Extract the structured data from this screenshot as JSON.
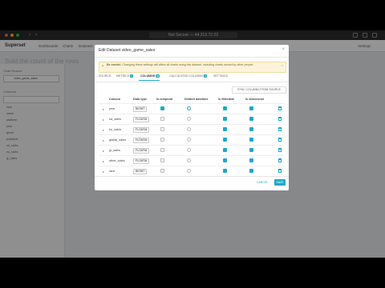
{
  "browser": {
    "url": "Not Secure — 44.213.72.22"
  },
  "app": {
    "brand": "Superset",
    "nav": [
      "Dashboards",
      "Charts",
      "Datasets"
    ],
    "settings": "Settings",
    "page_title": "Sold the count of the rows",
    "dataset_label": "Chart Source",
    "dataset_value": "video_game_sales",
    "filter_heading": "Columns",
    "metrics": [
      "rank",
      "name",
      "platform",
      "year",
      "genre",
      "publisher",
      "na_sales",
      "eu_sales",
      "jp_sales"
    ]
  },
  "modal": {
    "title": "Edit Dataset video_game_sales",
    "warning_bold": "Be careful.",
    "warning_text": "Changing these settings will affect all charts using this dataset, including charts owned by other people.",
    "tabs": [
      {
        "label": "SOURCE",
        "count": ""
      },
      {
        "label": "METRICS",
        "count": "1"
      },
      {
        "label": "COLUMNS",
        "count": "11"
      },
      {
        "label": "CALCULATED COLUMNS",
        "count": "0"
      },
      {
        "label": "SETTINGS",
        "count": ""
      }
    ],
    "sync_button": "SYNC COLUMNS FROM SOURCE",
    "headers": [
      "Column",
      "Data type",
      "Is temporal",
      "Default datetime",
      "Is filterable",
      "Is dimension"
    ],
    "rows": [
      {
        "name": "year",
        "type": "BIGINT",
        "temporal": true,
        "default_dt": true,
        "filterable": true,
        "dimension": true
      },
      {
        "name": "na_sales",
        "type": "FLOAT64",
        "temporal": false,
        "default_dt": false,
        "filterable": true,
        "dimension": true
      },
      {
        "name": "eu_sales",
        "type": "FLOAT64",
        "temporal": false,
        "default_dt": false,
        "filterable": true,
        "dimension": true
      },
      {
        "name": "global_sales",
        "type": "FLOAT64",
        "temporal": false,
        "default_dt": false,
        "filterable": true,
        "dimension": true
      },
      {
        "name": "jp_sales",
        "type": "FLOAT64",
        "temporal": false,
        "default_dt": false,
        "filterable": true,
        "dimension": true
      },
      {
        "name": "other_sales",
        "type": "FLOAT64",
        "temporal": false,
        "default_dt": false,
        "filterable": true,
        "dimension": true
      },
      {
        "name": "rank",
        "type": "BIGINT",
        "temporal": false,
        "default_dt": false,
        "filterable": true,
        "dimension": true
      }
    ],
    "cancel": "CANCEL",
    "save": "SAVE"
  },
  "colors": {
    "accent": "#20a7c9",
    "warning_bg": "#fcf3da"
  }
}
